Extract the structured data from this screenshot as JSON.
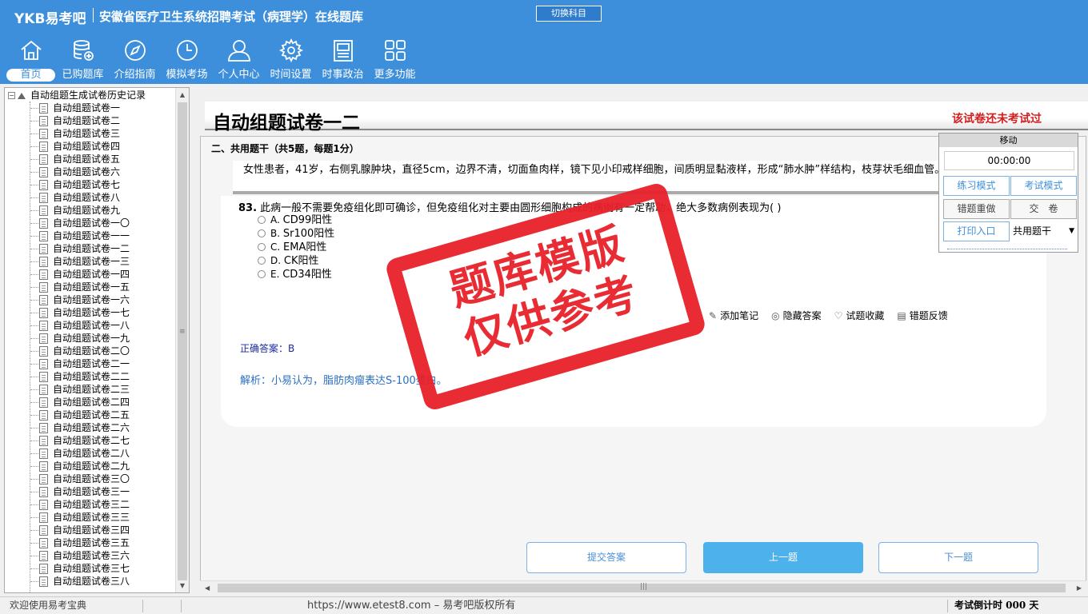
{
  "header": {
    "brand": "YKB易考吧",
    "title": "安徽省医疗卫生系统招聘考试（病理学）在线题库",
    "switch_subject": "切换科目"
  },
  "nav": [
    {
      "label": "首页",
      "icon": "home-icon"
    },
    {
      "label": "已购题库",
      "icon": "database-icon"
    },
    {
      "label": "介绍指南",
      "icon": "compass-icon"
    },
    {
      "label": "模拟考场",
      "icon": "clock-icon"
    },
    {
      "label": "个人中心",
      "icon": "user-icon"
    },
    {
      "label": "时间设置",
      "icon": "gear-icon"
    },
    {
      "label": "时事政治",
      "icon": "news-icon"
    },
    {
      "label": "更多功能",
      "icon": "grid-icon"
    }
  ],
  "sidebar": {
    "root": "自动组题生成试卷历史记录",
    "items": [
      "自动组题试卷一",
      "自动组题试卷二",
      "自动组题试卷三",
      "自动组题试卷四",
      "自动组题试卷五",
      "自动组题试卷六",
      "自动组题试卷七",
      "自动组题试卷八",
      "自动组题试卷九",
      "自动组题试卷一〇",
      "自动组题试卷一一",
      "自动组题试卷一二",
      "自动组题试卷一三",
      "自动组题试卷一四",
      "自动组题试卷一五",
      "自动组题试卷一六",
      "自动组题试卷一七",
      "自动组题试卷一八",
      "自动组题试卷一九",
      "自动组题试卷二〇",
      "自动组题试卷二一",
      "自动组题试卷二二",
      "自动组题试卷二三",
      "自动组题试卷二四",
      "自动组题试卷二五",
      "自动组题试卷二六",
      "自动组题试卷二七",
      "自动组题试卷二八",
      "自动组题试卷二九",
      "自动组题试卷三〇",
      "自动组题试卷三一",
      "自动组题试卷三二",
      "自动组题试卷三三",
      "自动组题试卷三四",
      "自动组题试卷三五",
      "自动组题试卷三六",
      "自动组题试卷三七",
      "自动组题试卷三八"
    ]
  },
  "paper": {
    "title": "自动组题试卷一二",
    "status": "该试卷还未考试过",
    "section": "二、共用题干（共5题，每题1分）",
    "stem": "女性患者，41岁，右侧乳腺肿块，直径5cm，边界不清，切面鱼肉样，镜下见小印戒样细胞，间质明显黏液样，形成“肺水肿”样结构，枝芽状毛细血管。",
    "question_number": "83.",
    "question": "此病一般不需要免疫组化即可确诊，但免疫组化对主要由圆形细胞构成的病例有一定帮助，绝大多数病例表现为( )",
    "options": [
      {
        "key": "A.",
        "text": "CD99阳性"
      },
      {
        "key": "B.",
        "text": "Sr100阳性"
      },
      {
        "key": "C.",
        "text": "EMA阳性"
      },
      {
        "key": "D.",
        "text": "CK阳性"
      },
      {
        "key": "E.",
        "text": "CD34阳性"
      }
    ],
    "tools": {
      "note": "添加笔记",
      "hide_answer": "隐藏答案",
      "favorite": "试题收藏",
      "feedback": "错题反馈"
    },
    "answer": "正确答案：B",
    "analysis": "解析：小易认为，脂肪肉瘤表达S-100蛋白。"
  },
  "buttons": {
    "submit": "提交答案",
    "prev": "上一题",
    "next": "下一题"
  },
  "stamp": {
    "line1": "题库模版",
    "line2": "仅供参考"
  },
  "panel": {
    "move": "移动",
    "timer": "00:00:00",
    "practice_mode": "练习模式",
    "exam_mode": "考试模式",
    "redo_wrong": "错题重做",
    "hand_in": "交　卷",
    "print": "打印入口",
    "type_select": "共用题干"
  },
  "status": {
    "welcome": "欢迎使用易考宝典",
    "url": "https://www.etest8.com – 易考吧版权所有",
    "countdown": "考试倒计时 000 天"
  },
  "colors": {
    "header": "#3d8fdc",
    "stamp": "#e8202a",
    "status_red": "#d41d1d"
  }
}
